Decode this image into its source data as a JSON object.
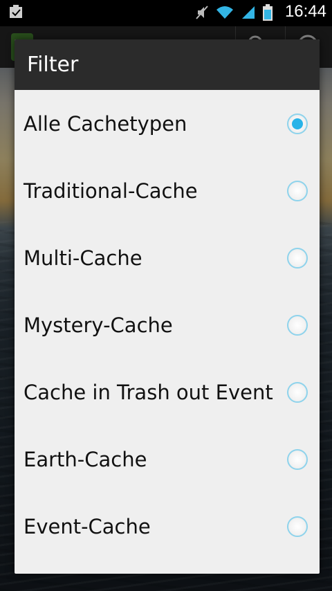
{
  "status_bar": {
    "time": "16:44",
    "icons": [
      "notification-icon",
      "mute-icon",
      "wifi-icon",
      "signal-icon",
      "battery-icon"
    ]
  },
  "dialog": {
    "title": "Filter",
    "options": [
      {
        "label": "Alle Cachetypen",
        "checked": true
      },
      {
        "label": "Traditional-Cache",
        "checked": false
      },
      {
        "label": "Multi-Cache",
        "checked": false
      },
      {
        "label": "Mystery-Cache",
        "checked": false
      },
      {
        "label": "Cache in Trash out Event",
        "checked": false
      },
      {
        "label": "Earth-Cache",
        "checked": false
      },
      {
        "label": "Event-Cache",
        "checked": false
      }
    ]
  },
  "colors": {
    "accent": "#27b3e8",
    "dialog_header": "#2b2b2b",
    "dialog_body": "#efefef"
  }
}
